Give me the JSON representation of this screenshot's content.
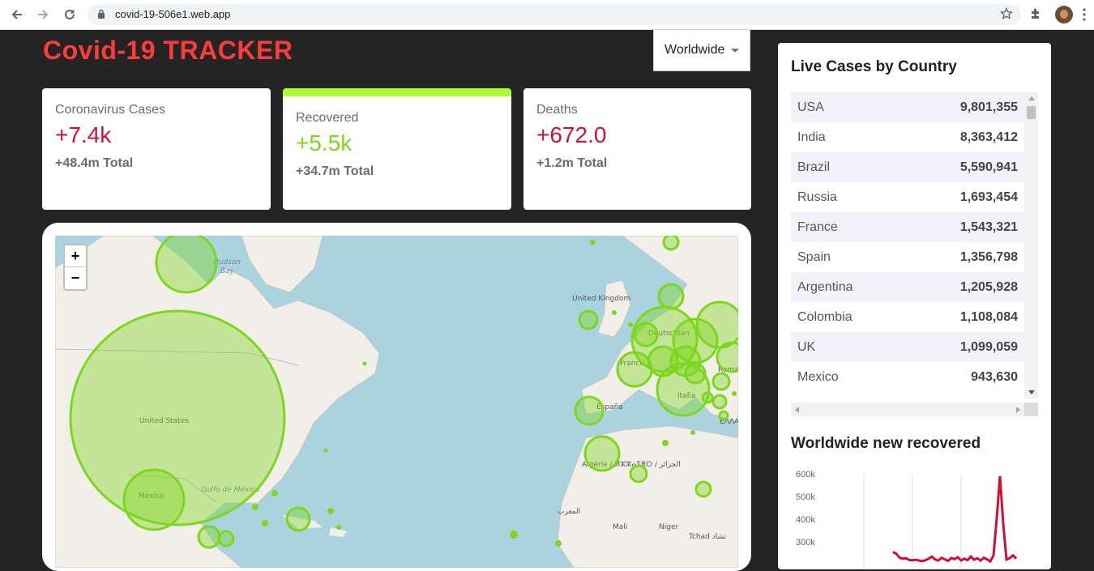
{
  "browser": {
    "url": "covid-19-506e1.web.app",
    "icons": [
      "back-arrow-icon",
      "forward-arrow-icon",
      "reload-icon",
      "lock-icon",
      "star-icon",
      "extensions-puzzle-icon",
      "profile-avatar",
      "more-vert-icon"
    ]
  },
  "app": {
    "title": "Covid-19 TRACKER",
    "country_selected": "Worldwide"
  },
  "stats": [
    {
      "title": "Coronavirus Cases",
      "value": "+7.4k",
      "total": "+48.4m",
      "total_label": "Total"
    },
    {
      "title": "Recovered",
      "value": "+5.5k",
      "total": "+34.7m",
      "total_label": "Total"
    },
    {
      "title": "Deaths",
      "value": "+672.0",
      "total": "+1.2m",
      "total_label": "Total"
    }
  ],
  "colors": {
    "title_red": "#ff3b3b",
    "cases_red": "#cc1034",
    "recovered_green": "#7dd71d",
    "selected_bar": "#adff2f",
    "circle_fill": "#7dd71d"
  },
  "map": {
    "zoom_in": "+",
    "zoom_out": "−",
    "labels": {
      "hudson_bay": "Hudson Bay",
      "united_states": "United States",
      "mexico": "México",
      "gulf": "Golfo de México",
      "uk": "United Kingdom",
      "deutschland": "Deutschlan",
      "france": "France",
      "espana": "España",
      "italia": "Italia",
      "algerie": "Algérie / ⵍⵣⵣⴰⵢⴻⵔ / الجزائر",
      "mali": "Mali",
      "niger": "Niger",
      "tchad": "Tchad تشاد",
      "maroc": "المغرب",
      "roma": "Roma",
      "ella": "ΕΛΛΑ"
    }
  },
  "live_cases": {
    "title": "Live Cases by Country",
    "rows": [
      {
        "country": "USA",
        "cases": "9,801,355"
      },
      {
        "country": "India",
        "cases": "8,363,412"
      },
      {
        "country": "Brazil",
        "cases": "5,590,941"
      },
      {
        "country": "Russia",
        "cases": "1,693,454"
      },
      {
        "country": "France",
        "cases": "1,543,321"
      },
      {
        "country": "Spain",
        "cases": "1,356,798"
      },
      {
        "country": "Argentina",
        "cases": "1,205,928"
      },
      {
        "country": "Colombia",
        "cases": "1,108,084"
      },
      {
        "country": "UK",
        "cases": "1,099,059"
      },
      {
        "country": "Mexico",
        "cases": "943,630"
      }
    ]
  },
  "chart_data": {
    "type": "line",
    "title": "Worldwide new recovered",
    "y_ticks": [
      "600k",
      "500k",
      "400k",
      "300k"
    ],
    "ylim": [
      0,
      650000
    ],
    "series": [
      {
        "values": [
          0,
          0,
          0,
          0,
          0,
          0,
          0,
          0,
          0,
          255000,
          248000,
          230000,
          226000,
          228000,
          220000,
          219000,
          221000,
          218000,
          215000,
          219000,
          226000,
          235000,
          222000,
          218000,
          230000,
          223000,
          216000,
          229000,
          224000,
          232000,
          218000,
          226000,
          219000,
          235000,
          221000,
          228000,
          217000,
          230000,
          223000,
          214000,
          240000,
          405000,
          590000,
          380000,
          222000,
          228000,
          240000,
          226000
        ]
      }
    ],
    "line_color": "#cc1034"
  }
}
